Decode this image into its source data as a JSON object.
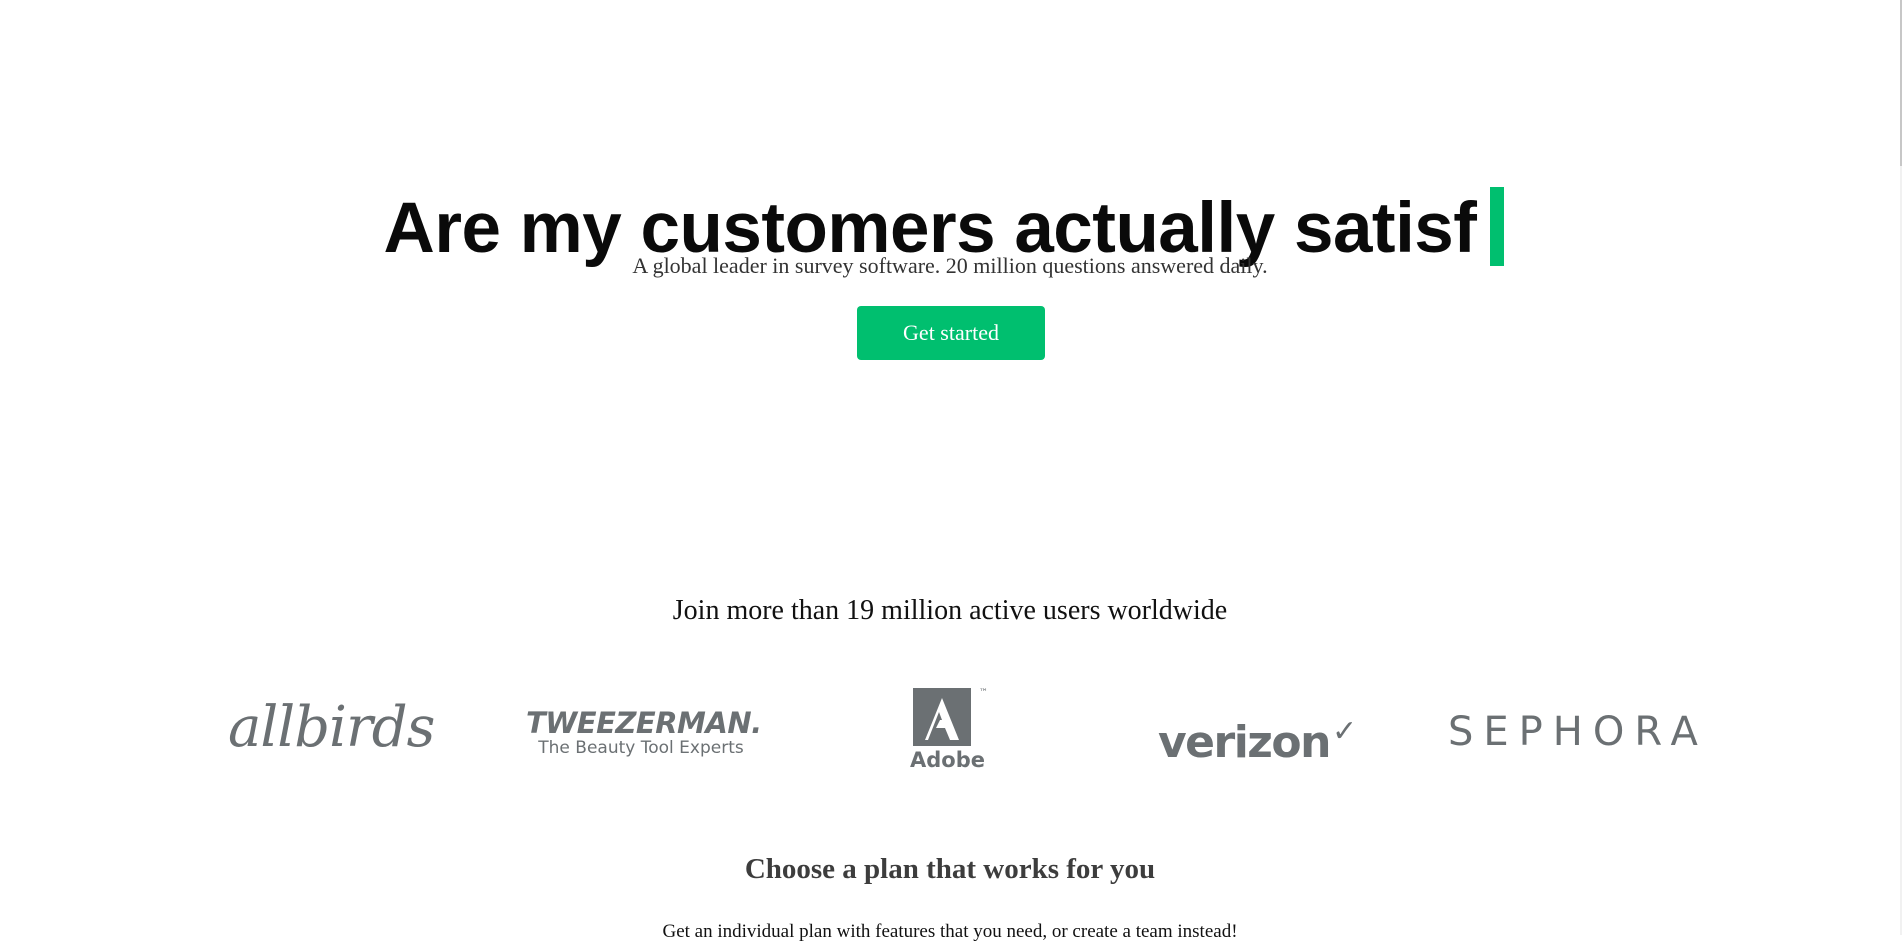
{
  "hero": {
    "typed_text": "Are my customers actually satisf",
    "subtitle": "A global leader in survey software. 20 million questions answered daily.",
    "cta_label": "Get started"
  },
  "social_proof": {
    "headline": "Join more than 19 million active users worldwide",
    "logos": {
      "allbirds": "allbirds",
      "tweezerman": "TWEEZERMAN.",
      "tweezerman_tagline": "The Beauty Tool Experts",
      "adobe": "Adobe",
      "adobe_tm": "™",
      "verizon": "verizon",
      "sephora": "SEPHORA"
    }
  },
  "plans": {
    "title": "Choose a plan that works for you",
    "subtitle": "Get an individual plan with features that you need, or create a team instead!"
  },
  "theme": {
    "accent": "#00bf6f",
    "logo_gray": "#6b7073"
  }
}
